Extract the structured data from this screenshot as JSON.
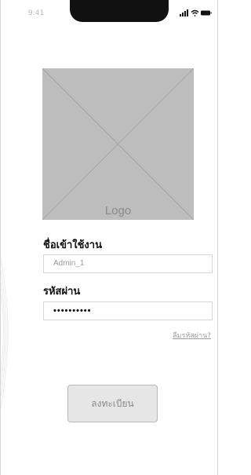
{
  "status_bar": {
    "time": "9:41",
    "icons": [
      "signal-icon",
      "wifi-icon",
      "battery-icon"
    ]
  },
  "logo": {
    "label": "Logo"
  },
  "form": {
    "username_label": "ชื่อเข้าใช้งาน",
    "username_value": "Admin_1",
    "password_label": "รหัสผ่าน",
    "password_value": "••••••••••",
    "forgot_password": "ลืมรหัสผ่าน?"
  },
  "register_button": "ลงทะเบียน",
  "colors": {
    "placeholder_gray": "#bdbdbd",
    "text": "#111111",
    "button_bg": "#e6e6e6"
  }
}
